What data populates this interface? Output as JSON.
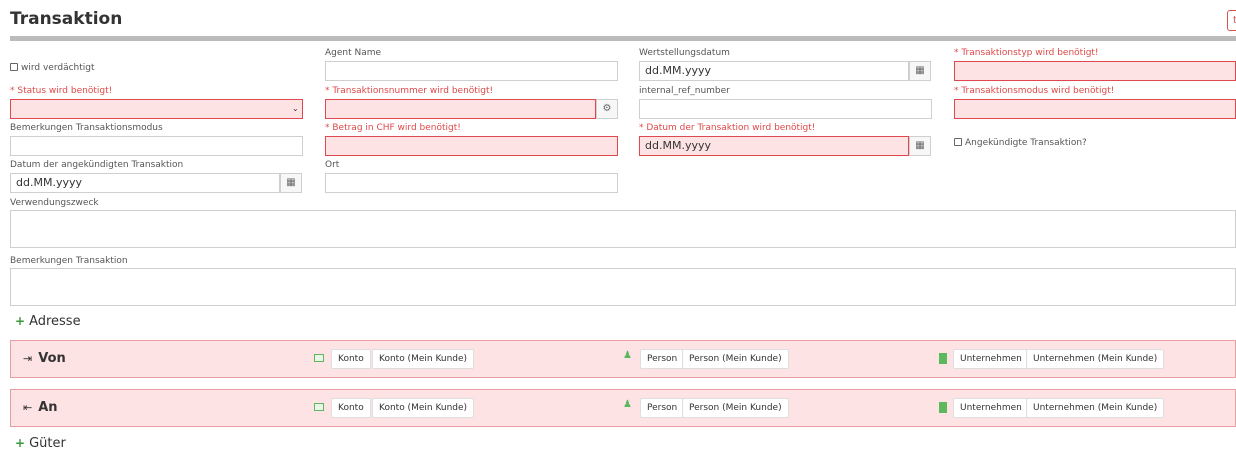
{
  "page": {
    "title": "Transaktion",
    "corner_button": "t"
  },
  "form": {
    "suspicious_checkbox": "wird verdächtigt",
    "agent_name_label": "Agent Name",
    "value_date_label": "Wertstellungsdatum",
    "value_date_placeholder": "dd.MM.yyyy",
    "transaction_type_label": "* Transaktionstyp wird benötigt!",
    "status_label": "* Status wird benötigt!",
    "transaction_number_label": "* Transaktionsnummer wird benötigt!",
    "internal_ref_label": "internal_ref_number",
    "transaction_mode_label": "* Transaktionsmodus wird benötigt!",
    "mode_remarks_label": "Bemerkungen Transaktionsmodus",
    "amount_label": "* Betrag in CHF wird benötigt!",
    "transaction_date_label": "* Datum der Transaktion wird benötigt!",
    "transaction_date_placeholder": "dd.MM.yyyy",
    "announced_checkbox": "Angekündigte Transaktion?",
    "announced_date_label": "Datum der angekündigten Transaktion",
    "announced_date_placeholder": "dd.MM.yyyy",
    "place_label": "Ort",
    "purpose_label": "Verwendungszweck",
    "remarks_label": "Bemerkungen Transaktion"
  },
  "sections": {
    "address": "Adresse",
    "goods": "Güter"
  },
  "parties": [
    {
      "title": "Von",
      "account_label": "Konto",
      "account_own": "Konto (Mein Kunde)",
      "person_label": "Person",
      "person_own": "Person (Mein Kunde)",
      "company_label": "Unternehmen",
      "company_own": "Unternehmen (Mein Kunde)"
    },
    {
      "title": "An",
      "account_label": "Konto",
      "account_own": "Konto (Mein Kunde)",
      "person_label": "Person",
      "person_own": "Person (Mein Kunde)",
      "company_label": "Unternehmen",
      "company_own": "Unternehmen (Mein Kunde)"
    }
  ],
  "colors": {
    "error_bg": "#fde3e4",
    "error_border": "#e0484f",
    "error_text": "#e04848",
    "accent_green": "#5cb85c"
  },
  "icons": {
    "calendar": "calendar-icon",
    "generate": "cogs-icon",
    "from": "sign-out-icon",
    "to": "sign-in-icon"
  }
}
